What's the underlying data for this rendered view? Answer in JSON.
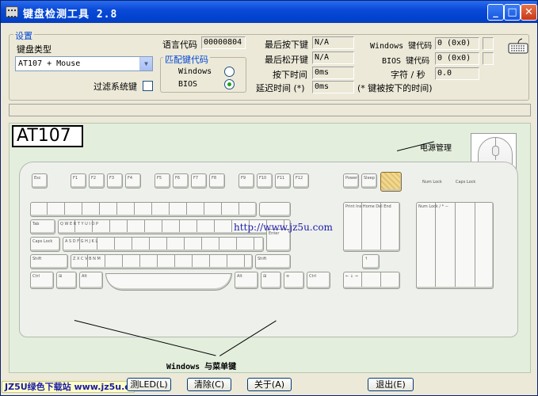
{
  "window": {
    "title": "键盘检测工具 2.8"
  },
  "settings": {
    "group_label": "设置",
    "keyboard_type_label": "键盘类型",
    "keyboard_type_value": "AT107 + Mouse",
    "filter_system_keys_label": "过滤系统键",
    "filter_system_keys_checked": false
  },
  "language": {
    "label": "语言代码",
    "value": "00000804"
  },
  "match_code": {
    "group_label": "匹配键代码",
    "windows_label": "Windows",
    "bios_label": "BIOS",
    "selected": "BIOS"
  },
  "status": {
    "last_pressed_label": "最后按下键",
    "last_pressed_value": "N/A",
    "last_released_label": "最后松开键",
    "last_released_value": "N/A",
    "press_time_label": "按下时间",
    "press_time_value": "0ms",
    "delay_time_label": "延迟时间 (*)",
    "delay_time_value": "0ms",
    "windows_code_label": "Windows 键代码",
    "windows_code_value": "0 (0x0)",
    "bios_code_label": "BIOS 键代码",
    "bios_code_value": "0 (0x0)",
    "cps_label": "字符 / 秒",
    "cps_value": "0.0",
    "note": "(* 键被按下的时间)"
  },
  "keyboard": {
    "model_label": "AT107",
    "power_label": "电源管理",
    "url": "http://www.jz5u.com",
    "windows_menu_label": "Windows 与菜单键",
    "indicators": [
      "Num Lock",
      "Caps Lock",
      "Scroll Lock"
    ]
  },
  "buttons": {
    "led": "测LED(L)",
    "clear": "清除(C)",
    "about": "关于(A)",
    "exit": "退出(E)"
  },
  "watermark": "JZ5U绿色下载站 www.jz5u.com",
  "colors": {
    "title_bar": "#0a4ad6",
    "group_label": "#0046d5",
    "power_highlight": "#f0d890"
  }
}
